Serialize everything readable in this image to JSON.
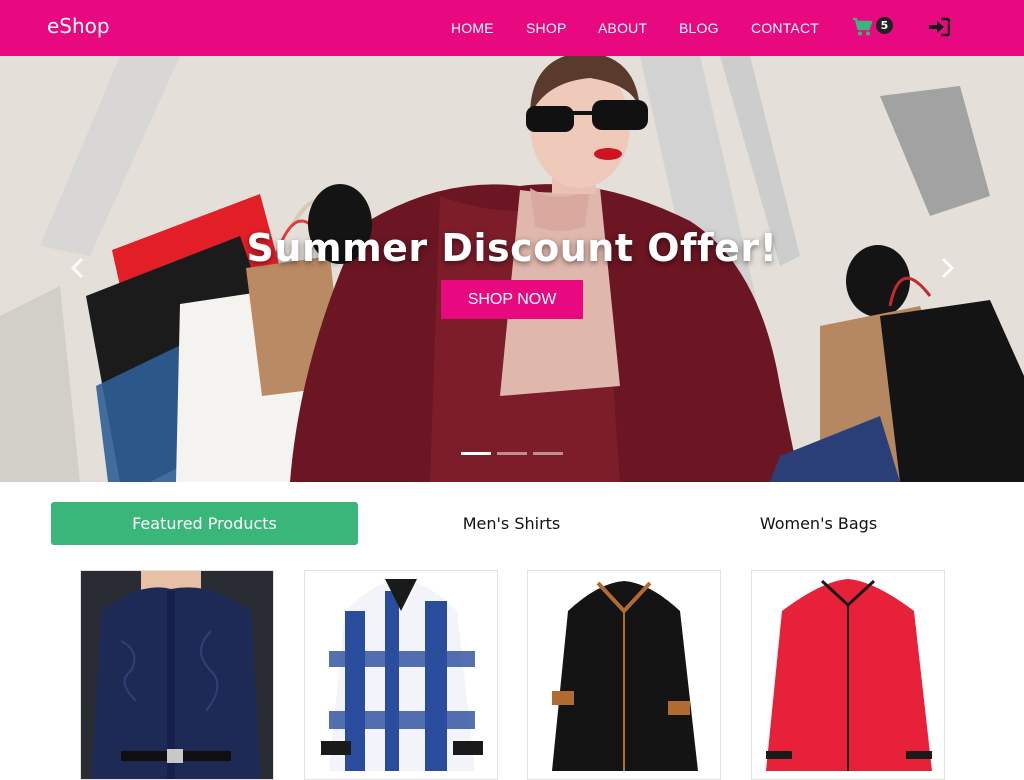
{
  "brand": "eShop",
  "nav": {
    "links": [
      "HOME",
      "SHOP",
      "ABOUT",
      "BLOG",
      "CONTACT"
    ],
    "cart_count": "5",
    "icons": {
      "cart": "shopping-cart-icon",
      "login": "sign-in-icon"
    }
  },
  "hero": {
    "title": "Summer Discount Offer!",
    "button": "SHOP NOW",
    "slides": 3,
    "active_slide": 1
  },
  "tabs": {
    "items": [
      "Featured Products",
      "Men's Shirts",
      "Women's Bags"
    ],
    "active": 0
  },
  "products": [
    {
      "name": "navy-floral-shirt",
      "color": "#1d2a55"
    },
    {
      "name": "blue-plaid-shirt",
      "color": "#2a4c9c"
    },
    {
      "name": "black-shirt-brown-trim",
      "color": "#141414"
    },
    {
      "name": "red-shirt-black-trim",
      "color": "#e8213a"
    }
  ],
  "colors": {
    "brand": "#e8087f",
    "accent": "#3bb67b"
  }
}
